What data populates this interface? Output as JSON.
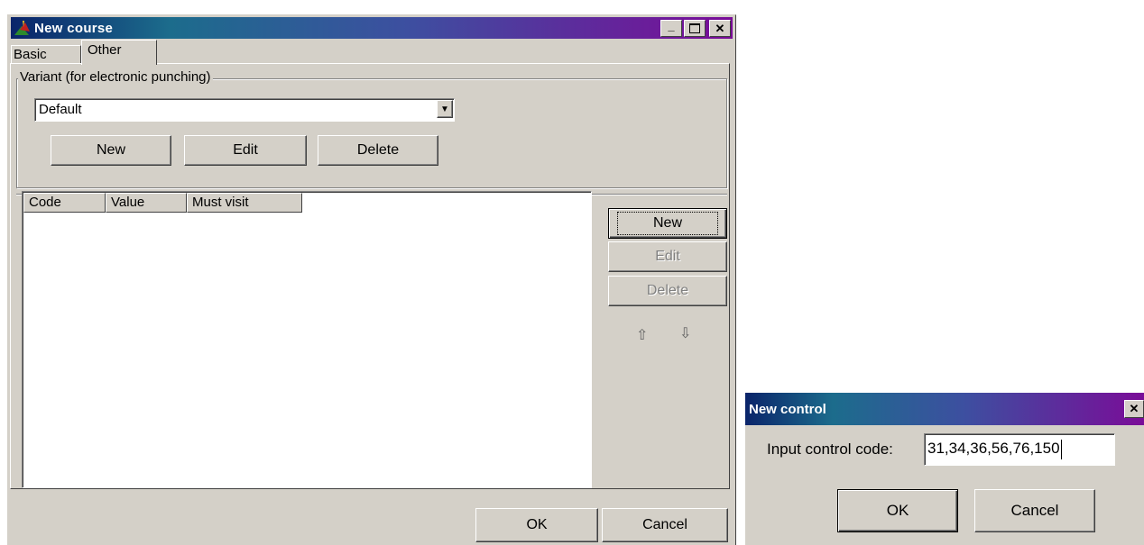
{
  "main_window": {
    "title": "New course",
    "minimize_symbol": "_",
    "maximize_symbol": "□",
    "close_symbol": "✕",
    "tabs": [
      {
        "label": "Basic",
        "active": false
      },
      {
        "label": "Other",
        "active": true
      }
    ],
    "variant_group": {
      "legend": "Variant (for electronic punching)",
      "selected": "Default",
      "buttons": {
        "new": "New",
        "edit": "Edit",
        "delete": "Delete"
      }
    },
    "controls_list": {
      "columns": [
        "Code",
        "Value",
        "Must visit"
      ],
      "rows": []
    },
    "list_buttons": {
      "new": "New",
      "edit": "Edit",
      "delete": "Delete"
    },
    "move_up_symbol": "⇧",
    "move_down_symbol": "⇩",
    "footer": {
      "ok": "OK",
      "cancel": "Cancel"
    }
  },
  "dialog": {
    "title": "New control",
    "close_symbol": "✕",
    "label": "Input control code:",
    "input_value": "31,34,36,56,76,150",
    "ok": "OK",
    "cancel": "Cancel"
  },
  "colors": {
    "window_face": "#d4d0c8",
    "title_start": "#0a246a",
    "title_end": "#7a0c98"
  }
}
